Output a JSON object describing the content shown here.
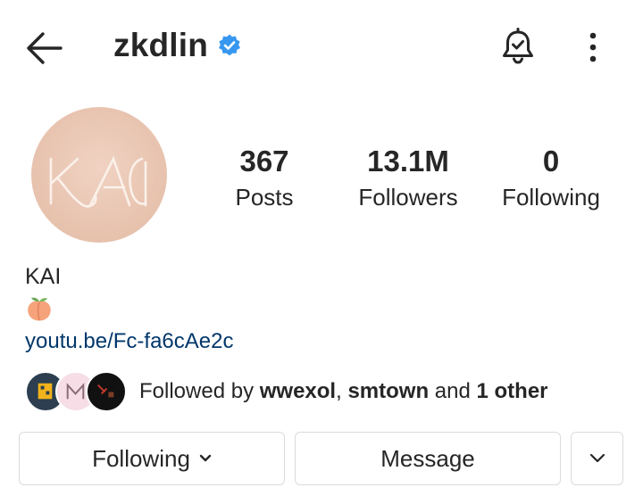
{
  "header": {
    "username": "zkdlin",
    "verified": true,
    "icons": [
      "back-arrow-icon",
      "verified-badge-icon",
      "notification-bell-icon",
      "more-vertical-icon"
    ]
  },
  "profile": {
    "avatar_text": "KAI",
    "display_name": "KAI",
    "bio_emoji": "peach",
    "link": "youtu.be/Fc-fa6cAe2c"
  },
  "stats": {
    "posts": {
      "value": "367",
      "label": "Posts"
    },
    "followers": {
      "value": "13.1M",
      "label": "Followers"
    },
    "following": {
      "value": "0",
      "label": "Following"
    }
  },
  "followed_by": {
    "prefix": "Followed by ",
    "user1": "wwexol",
    "sep": ", ",
    "user2": "smtown",
    "and": " and ",
    "others": "1 other"
  },
  "actions": {
    "following_label": "Following",
    "message_label": "Message"
  },
  "colors": {
    "text": "#262626",
    "link": "#00376b",
    "verified": "#3797f0",
    "border": "#dbdbdb"
  }
}
